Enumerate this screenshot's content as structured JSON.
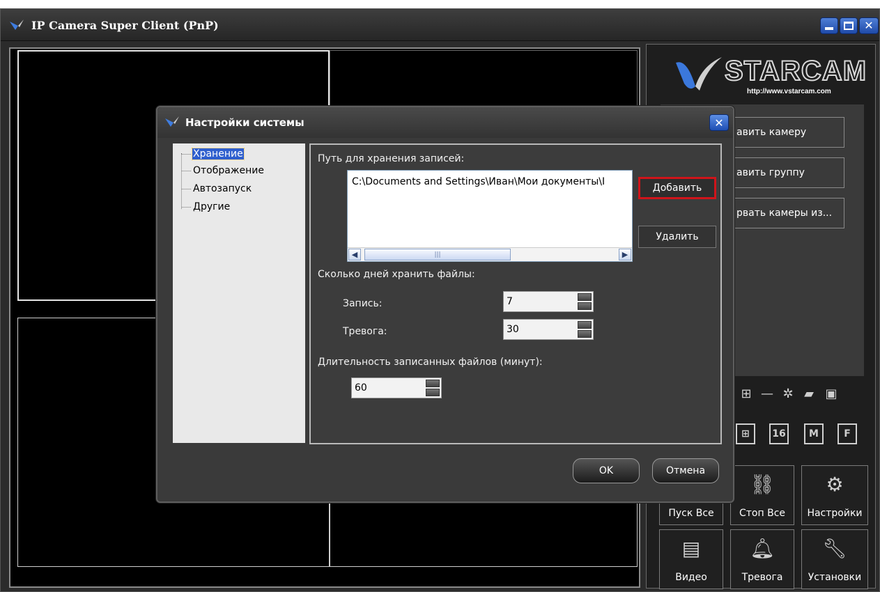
{
  "window": {
    "title": "IP Camera Super Client (PnP)"
  },
  "logo": {
    "brand": "STARCAM",
    "url": "http://www.vstarcam.com"
  },
  "right_panel": {
    "buttons": [
      "авить камеру",
      "авить группу",
      "рвать камеры из..."
    ],
    "layout_buttons": [
      "16",
      "M",
      "F"
    ],
    "big_buttons": [
      {
        "label": "Пуск Все",
        "icon": "play-all-icon"
      },
      {
        "label": "Стоп Все",
        "icon": "stop-all-icon"
      },
      {
        "label": "Настройки",
        "icon": "settings-icon"
      },
      {
        "label": "Видео",
        "icon": "video-icon"
      },
      {
        "label": "Тревога",
        "icon": "bell-icon"
      },
      {
        "label": "Установки",
        "icon": "wrench-icon"
      }
    ]
  },
  "dialog": {
    "title": "Настройки системы",
    "tree": [
      "Хранение",
      "Отображение",
      "Автозапуск",
      "Другие"
    ],
    "selected_tree_item": "Хранение",
    "storage_path_label": "Путь для хранения записей:",
    "storage_path_value": "C:\\Documents and Settings\\Иван\\Мои документы\\I",
    "add_label": "Добавить",
    "delete_label": "Удалить",
    "days_label": "Сколько дней хранить файлы:",
    "record_label": "Запись:",
    "record_value": "7",
    "alarm_label": "Тревога:",
    "alarm_value": "30",
    "duration_label": "Длительность записанных файлов (минут):",
    "duration_value": "60",
    "ok_label": "OK",
    "cancel_label": "Отмена"
  },
  "colors": {
    "highlight_red": "#d0141a",
    "selection_blue": "#2f5fce",
    "window_button_blue": "#1f4aa8"
  }
}
